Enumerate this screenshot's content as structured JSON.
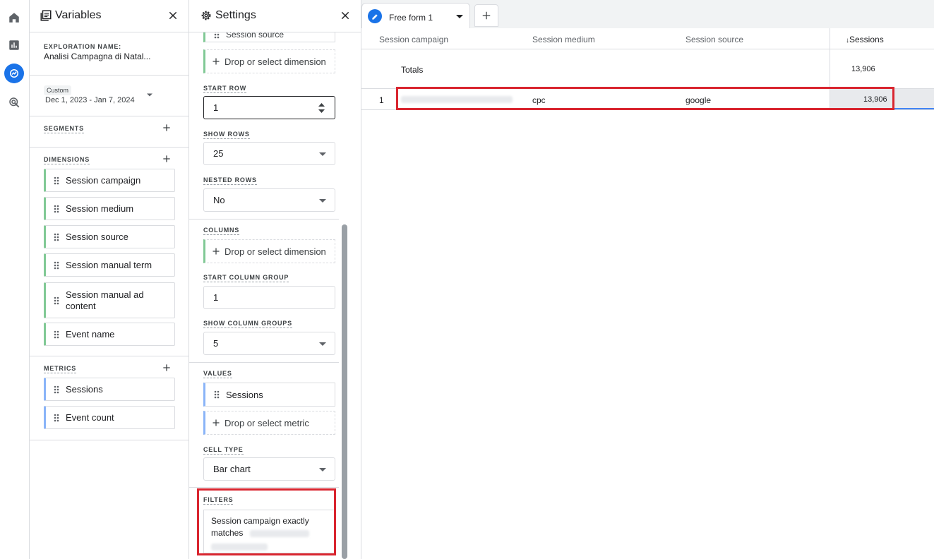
{
  "rail": {
    "items": [
      {
        "name": "home-icon"
      },
      {
        "name": "reports-icon"
      },
      {
        "name": "explore-icon",
        "active": true
      },
      {
        "name": "advertising-icon"
      }
    ]
  },
  "variables": {
    "title": "Variables",
    "exploration_label": "EXPLORATION NAME:",
    "exploration_name": "Analisi Campagna di Natal...",
    "date_chip": "Custom",
    "date_range": "Dec 1, 2023 - Jan 7, 2024",
    "segments_label": "SEGMENTS",
    "dimensions_label": "DIMENSIONS",
    "dimensions": [
      "Session campaign",
      "Session medium",
      "Session source",
      "Session manual term",
      "Session manual ad content",
      "Event name"
    ],
    "metrics_label": "METRICS",
    "metrics": [
      "Sessions",
      "Event count"
    ]
  },
  "settings": {
    "title": "Settings",
    "rows_top_chip": "Session source",
    "drop_dimension": "Drop or select dimension",
    "start_row_label": "START ROW",
    "start_row_value": "1",
    "show_rows_label": "SHOW ROWS",
    "show_rows_value": "25",
    "nested_rows_label": "NESTED ROWS",
    "nested_rows_value": "No",
    "columns_label": "COLUMNS",
    "columns_drop": "Drop or select dimension",
    "start_column_group_label": "START COLUMN GROUP",
    "start_column_group_value": "1",
    "show_column_groups_label": "SHOW COLUMN GROUPS",
    "show_column_groups_value": "5",
    "values_label": "VALUES",
    "values_chip": "Sessions",
    "drop_metric": "Drop or select metric",
    "cell_type_label": "CELL TYPE",
    "cell_type_value": "Bar chart",
    "filters_label": "FILTERS",
    "filter_text": "Session campaign exactly matches"
  },
  "main": {
    "tab_label": "Free form 1",
    "headers": [
      "Session campaign",
      "Session medium",
      "Session source",
      "Sessions"
    ],
    "sort_arrow": "↓",
    "totals_label": "Totals",
    "totals_value": "13,906",
    "rows": [
      {
        "index": "1",
        "medium": "cpc",
        "source": "google",
        "sessions": "13,906"
      }
    ]
  },
  "colors": {
    "accent": "#1a73e8",
    "dimension_bar": "#81c995",
    "metric_bar": "#8ab4f8",
    "highlight": "#d9252f"
  }
}
